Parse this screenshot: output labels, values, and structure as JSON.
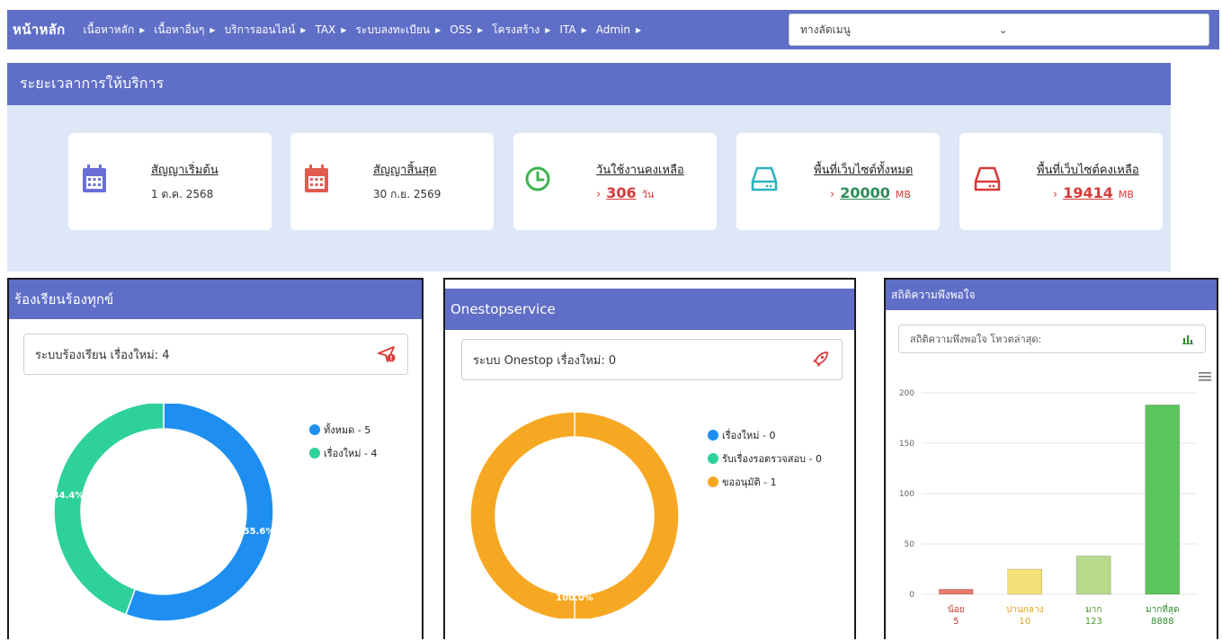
{
  "nav": {
    "home": "หน้าหลัก",
    "items": [
      {
        "label": "เนื้อหาหลัก"
      },
      {
        "label": "เนื้อหาอื่นๆ"
      },
      {
        "label": "บริการออนไลน์"
      },
      {
        "label": "TAX"
      },
      {
        "label": "ระบบลงทะเบียน"
      },
      {
        "label": "OSS"
      },
      {
        "label": "โครงสร้าง"
      },
      {
        "label": "ITA"
      },
      {
        "label": "Admin"
      }
    ],
    "shortcut_placeholder": "ทางลัดเมนู"
  },
  "service": {
    "title": "ระยะเวลาการให้บริการ",
    "cards": [
      {
        "title": "สัญญาเริ่มต้น",
        "value": "1 ต.ค. 2568",
        "icon": "calendar-icon",
        "color": "#6a6fd8"
      },
      {
        "title": "สัญญาสิ้นสุด",
        "value": "30 ก.ย. 2569",
        "icon": "calendar-icon",
        "color": "#e25b4f"
      },
      {
        "title": "วันใช้งานคงเหลือ",
        "number": "306",
        "unit": "วัน",
        "icon": "clock-icon",
        "color": "#3fb34f",
        "num_color": "#d93a3a"
      },
      {
        "title": "พื้นที่เว็บไซต์ทั้งหมด",
        "number": "20000",
        "unit": "MB",
        "icon": "hard-drive-icon",
        "color": "#2bb3bf",
        "num_color": "#2e8b57"
      },
      {
        "title": "พื้นที่เว็บไซต์คงเหลือ",
        "number": "19414",
        "unit": "MB",
        "icon": "hard-drive-icon",
        "color": "#d93a3a",
        "num_color": "#d93a3a"
      }
    ]
  },
  "complaints": {
    "title": "ร้องเรียนร้องทุกข์",
    "search_label": "ระบบร้องเรียน เรื่องใหม่: 4",
    "legend": [
      {
        "label": "ทั้งหมด - 5",
        "color": "#1e8ff0"
      },
      {
        "label": "เรื่องใหม่ - 4",
        "color": "#2ed19b"
      }
    ],
    "slices": [
      {
        "label": "55.6%",
        "value": 55.6,
        "color": "#1e8ff0"
      },
      {
        "label": "44.4%",
        "value": 44.4,
        "color": "#2ed19b"
      }
    ]
  },
  "onestop": {
    "title": "Onestopservice",
    "search_label": "ระบบ Onestop เรื่องใหม่: 0",
    "legend": [
      {
        "label": "เรื่องใหม่ - 0",
        "color": "#1e8ff0"
      },
      {
        "label": "รับเรื่องรอตรวจสอบ - 0",
        "color": "#2ed19b"
      },
      {
        "label": "ขออนุมัติ - 1",
        "color": "#f7a823"
      }
    ],
    "slices": [
      {
        "label": "100.0%",
        "value": 100,
        "color": "#f7a823"
      }
    ]
  },
  "satisfaction": {
    "title": "สถิติความพึงพอใจ",
    "select_label": "สถิติความพึงพอใจ โหวตล่าสุด:",
    "chart_data": {
      "type": "bar",
      "categories": [
        "น้อย",
        "ปานกลาง",
        "มาก",
        "มากที่สุด"
      ],
      "counts": [
        "5",
        "10",
        "123",
        "8888"
      ],
      "values": [
        5,
        25,
        38,
        188
      ],
      "colors": [
        "#e87a6a",
        "#f5e07a",
        "#b6d98a",
        "#5cc45c"
      ],
      "label_colors": [
        "#c0392b",
        "#e3a020",
        "#4a9a2a",
        "#2e8b2e"
      ],
      "ylim": [
        0,
        200
      ],
      "yticks": [
        0,
        50,
        100,
        150,
        200
      ]
    }
  }
}
